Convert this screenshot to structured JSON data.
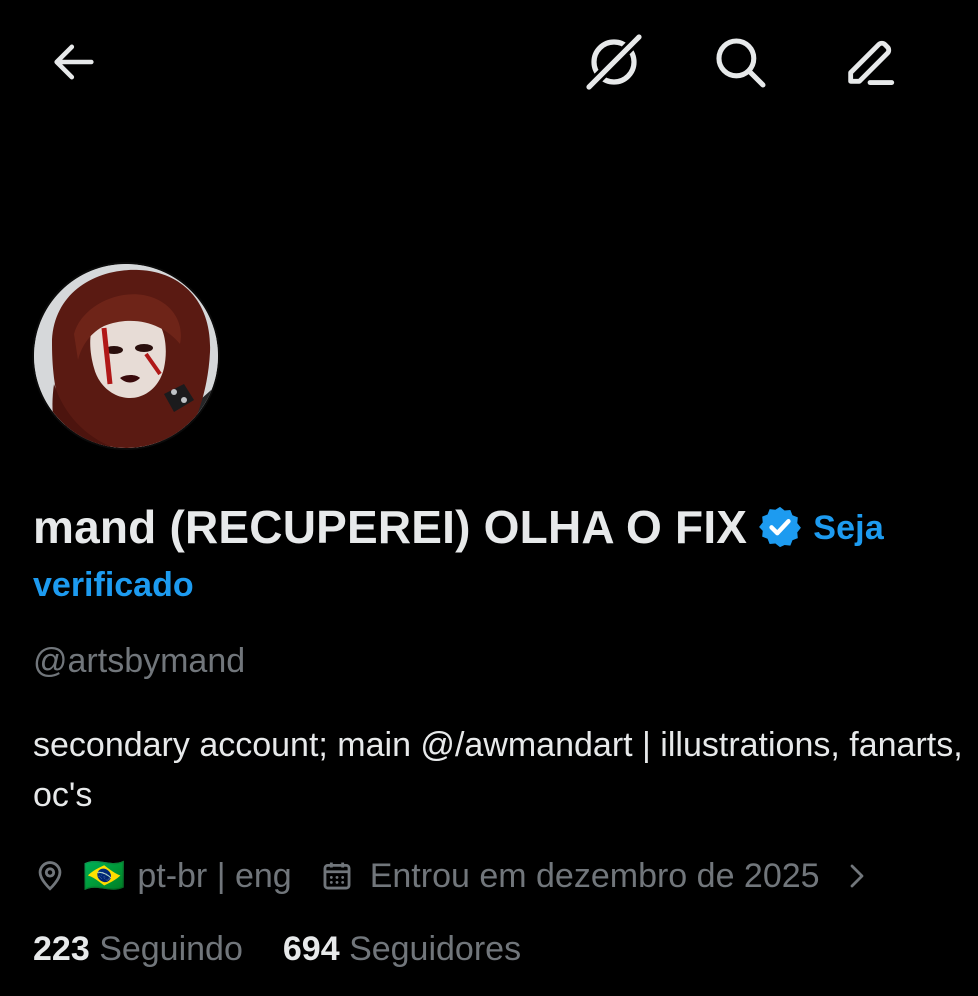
{
  "header": {
    "back_icon": "arrow-left-icon",
    "grok_icon": "grok-icon",
    "search_icon": "search-icon",
    "edit_icon": "edit-icon"
  },
  "profile": {
    "avatar_icon": "profile-avatar",
    "display_name": "mand (RECUPEREI) OLHA O FIX",
    "verified_icon": "verified-badge-icon",
    "promo_line1": "Seja",
    "promo_line2": "verificado",
    "handle": "@artsbymand",
    "bio": "secondary account; main @/awmandart | illustrations, fanarts, oc's",
    "location_icon": "location-pin-icon",
    "location_flag": "🇧🇷",
    "location": "pt-br | eng",
    "calendar_icon": "calendar-icon",
    "joined": "Entrou em dezembro de 2025",
    "chevron_icon": "chevron-right-icon",
    "following_count": "223",
    "following_label": "Seguindo",
    "followers_count": "694",
    "followers_label": "Seguidores"
  },
  "colors": {
    "background": "#000000",
    "text_primary": "#e7e9ea",
    "text_secondary": "#71767b",
    "accent": "#1d9bf0"
  }
}
